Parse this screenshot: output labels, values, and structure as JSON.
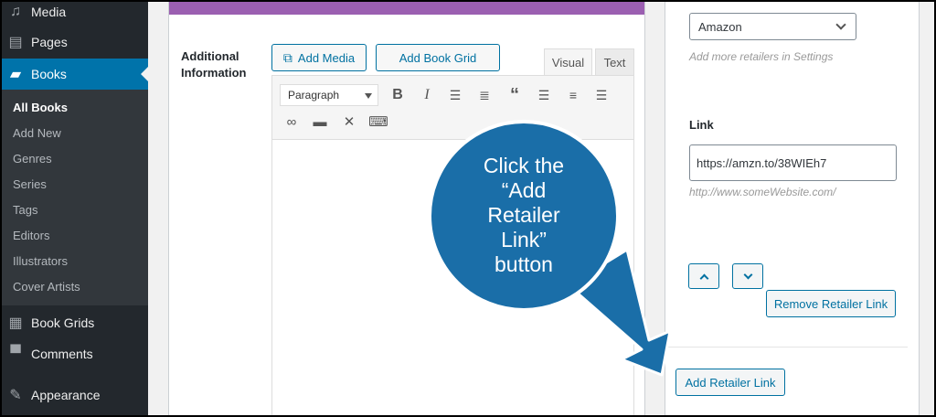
{
  "sidebar": {
    "items": [
      {
        "label": "Media",
        "icon": "media-icon"
      },
      {
        "label": "Pages",
        "icon": "pages-icon"
      },
      {
        "label": "Books",
        "icon": "books-icon"
      },
      {
        "label": "Book Grids",
        "icon": "grid-icon"
      },
      {
        "label": "Comments",
        "icon": "comments-icon"
      },
      {
        "label": "Appearance",
        "icon": "appearance-icon"
      }
    ],
    "submenu": [
      "All Books",
      "Add New",
      "Genres",
      "Series",
      "Tags",
      "Editors",
      "Illustrators",
      "Cover Artists"
    ]
  },
  "editor": {
    "field_label": "Additional Information",
    "add_media": "Add Media",
    "add_book_grid": "Add Book Grid",
    "tab_visual": "Visual",
    "tab_text": "Text",
    "format": "Paragraph"
  },
  "retailer": {
    "selected": "Amazon",
    "select_hint": "Add more retailers in Settings",
    "link_label": "Link",
    "link_value": "https://amzn.to/38WIEh7",
    "link_hint": "http://www.someWebsite.com/",
    "remove_label": "Remove Retailer Link",
    "add_label": "Add Retailer Link"
  },
  "callout": {
    "lines": [
      "Click the",
      "“Add",
      "Retailer",
      "Link”",
      "button"
    ]
  },
  "colors": {
    "sidebar_bg": "#23282d",
    "active_blue": "#0073aa",
    "callout_blue": "#1a6ea8",
    "header_purple": "#9b5fb1"
  }
}
